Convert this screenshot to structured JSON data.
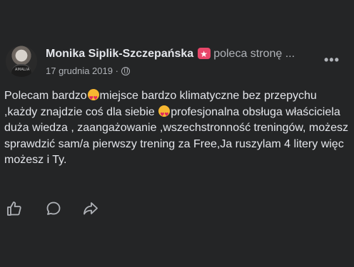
{
  "post": {
    "author": "Monika Siplik-Szczepańska",
    "action_text": "poleca stronę ...",
    "date": "17 grudnia 2019 ·",
    "text_parts": [
      "Polecam bardzo",
      "miejsce bardzo klimatyczne bez przepychu ,każdy znajdzie coś dla siebie ",
      "profesjonalna obsługa właściciela duża wiedza , zaangażowanie ,wszechstronność treningów, możesz sprawdzić sam/a pierwszy trening za Free,Ja ruszylam  4 litery więc możesz i Ty."
    ],
    "more_label": "•••"
  },
  "avatar_shirt_text": "AMALIA",
  "icons": {
    "recommend": "star-badge-icon",
    "privacy": "globe-icon",
    "emoji": "heart-eyes-emoji-icon",
    "like": "thumbs-up-icon",
    "comment": "comment-icon",
    "share": "share-icon"
  },
  "colors": {
    "background": "#242526",
    "text_primary": "#e4e6eb",
    "text_secondary": "#b0b3b8",
    "badge": "#e8476a"
  }
}
